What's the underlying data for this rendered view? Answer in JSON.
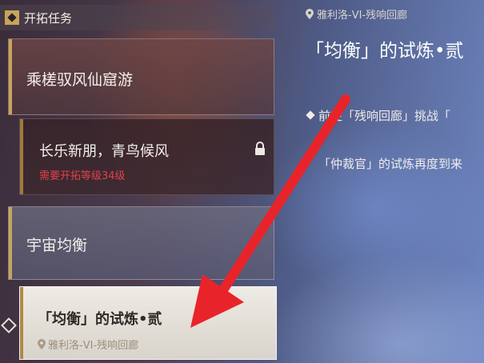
{
  "section": {
    "title": "开拓任务"
  },
  "quest_list": {
    "category_1": "乘槎驭风仙窟游",
    "locked_quest": {
      "label": "长乐新朋，青鸟候风",
      "requirement": "需要开拓等级34级"
    },
    "category_2": "宇宙均衡",
    "selected_quest": {
      "label": "「均衡」的试炼•贰",
      "location": "雅利洛-VI-残响回廊"
    }
  },
  "detail": {
    "location": "雅利洛-VI-残响回廊",
    "title": "「均衡」的试炼•贰",
    "objective": "前往「残响回廊」挑战「",
    "description": "「仲裁官」的试炼再度到来"
  },
  "colors": {
    "accent_gold": "#c9a45a",
    "lock_red": "#e0414b",
    "arrow_red": "#e8242a"
  },
  "icons": [
    "diamond-icon",
    "lock-icon",
    "location-pin-icon",
    "selector-diamond-icon",
    "red-arrow-annotation"
  ]
}
